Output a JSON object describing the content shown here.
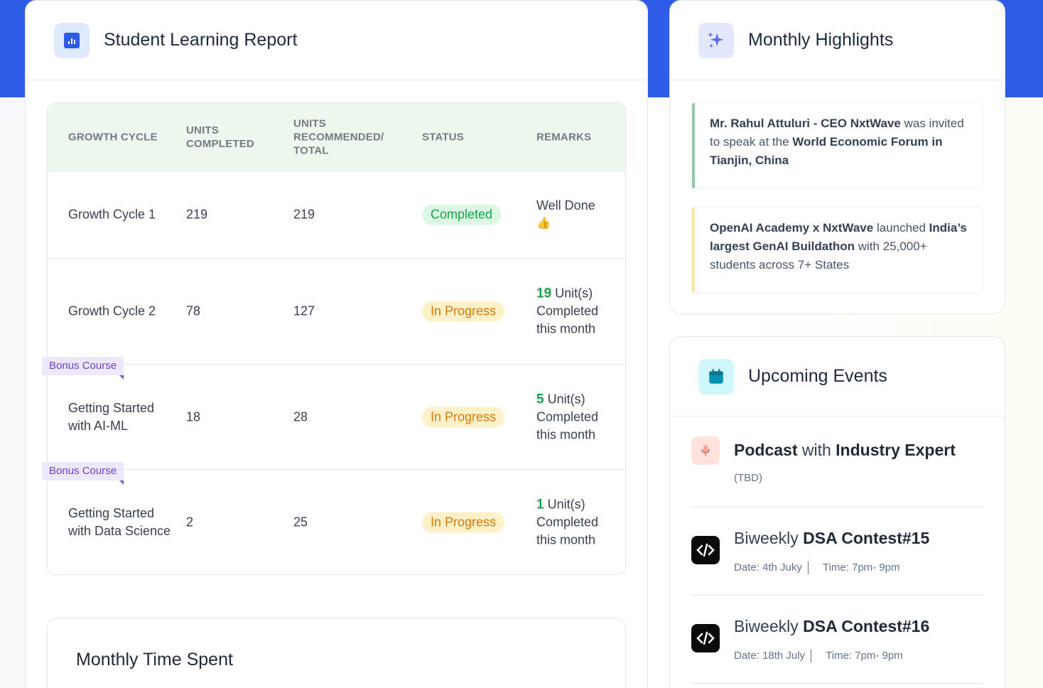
{
  "report": {
    "title": "Student Learning Report",
    "icon": "bar-chart-icon",
    "columns": [
      "GROWTH CYCLE",
      "UNITS COMPLETED",
      "UNITS RECOMMENDED/ TOTAL",
      "STATUS",
      "REMARKS"
    ],
    "rows": [
      {
        "name": "Growth Cycle 1",
        "completed": "219",
        "total": "219",
        "status": "Completed",
        "remark": "Well Done",
        "remark_emoji": "👍"
      },
      {
        "name": "Growth Cycle 2",
        "completed": "78",
        "total": "127",
        "status": "In Progress",
        "remark_num": "19",
        "remark_unit": "Unit(s)",
        "remark_rest1": "Completed",
        "remark_rest2": "this month"
      },
      {
        "tag": "Bonus Course",
        "name1": "Getting Started",
        "name2": "with AI-ML",
        "completed": "18",
        "total": "28",
        "status": "In Progress",
        "remark_num": "5",
        "remark_unit": "Unit(s)",
        "remark_rest1": "Completed",
        "remark_rest2": "this month"
      },
      {
        "tag": "Bonus Course",
        "name1": "Getting Started",
        "name2": "with Data Science",
        "completed": "2",
        "total": "25",
        "status": "In Progress",
        "remark_num": "1",
        "remark_unit": "Unit(s)",
        "remark_rest1": "Completed",
        "remark_rest2": "this month"
      }
    ]
  },
  "time_spent": {
    "title": "Monthly Time Spent"
  },
  "highlights": {
    "title": "Monthly Highlights",
    "icon": "sparkle-icon",
    "items": [
      {
        "b1": "Mr. Rahul Attuluri - CEO NxtWave",
        "t1": " was invited to speak at the ",
        "b2": "World Economic Forum in Tianjin, China",
        "t2": ""
      },
      {
        "b1": "OpenAI Academy x NxtWave",
        "t1": " launched ",
        "b2": "India’s largest GenAI Buildathon",
        "t2": " with 25,000+ students across 7+ States"
      }
    ]
  },
  "events": {
    "title": "Upcoming Events",
    "icon": "calendar-icon",
    "items": [
      {
        "b1": "Podcast",
        "t1": " with ",
        "b2": "Industry Expert",
        "sub": "(TBD)",
        "icon": "microphone-icon"
      },
      {
        "t0": "Biweekly ",
        "b1": "DSA Contest#15",
        "date": "Date: 4th Juky",
        "time": "Time: 7pm- 9pm",
        "icon": "code-icon"
      },
      {
        "t0": "Biweekly ",
        "b1": "DSA Contest#16",
        "date": "Date: 18th July",
        "time": "Time: 7pm- 9pm",
        "icon": "code-icon"
      }
    ]
  }
}
